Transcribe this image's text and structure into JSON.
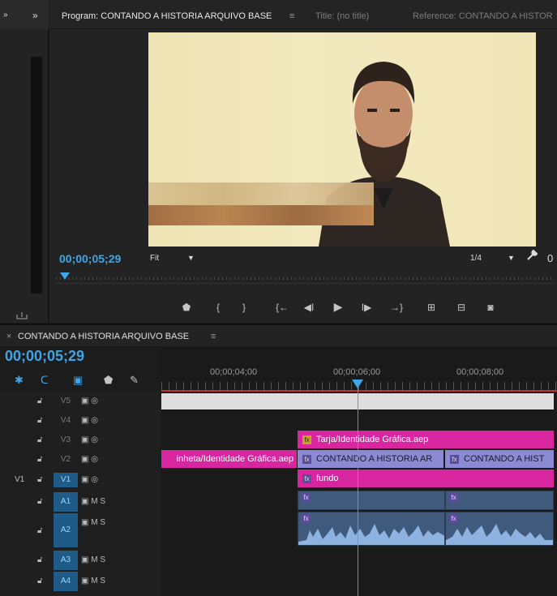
{
  "left_panel": {
    "tab_partial": "»",
    "tab_arrow": "»",
    "bottom_icon": "export-icon"
  },
  "program_monitor": {
    "tab_program": "Program: CONTANDO A HISTORIA ARQUIVO BASE",
    "tab_menu": "≡",
    "tab_title": "Title: (no title)",
    "tab_reference": "Reference: CONTANDO A HISTOR",
    "timecode": "00;00;05;29",
    "fit_label": "Fit",
    "resolution": "1/4",
    "zoom_partial": "0"
  },
  "transport": [
    "marker-icon",
    "mark-in-icon",
    "mark-out-icon",
    "go-to-in-icon",
    "step-back-icon",
    "play-icon",
    "step-forward-icon",
    "go-to-out-icon",
    "lift-icon",
    "extract-icon",
    "export-frame-icon"
  ],
  "timeline": {
    "close": "×",
    "sequence_name": "CONTANDO A HISTORIA ARQUIVO BASE",
    "menu": "≡",
    "timecode": "00;00;05;29",
    "ruler": [
      "00;00;04;00",
      "00;00;06;00",
      "00;00;08;00"
    ],
    "tracks": [
      {
        "name": "V5",
        "icons": "▣ ◎"
      },
      {
        "name": "V4",
        "icons": "▣ ◎"
      },
      {
        "name": "V3",
        "icons": "▣ ◎"
      },
      {
        "name": "V2",
        "icons": "▣ ◎"
      },
      {
        "name": "V1",
        "src": "V1",
        "icons": "▣ ◎"
      },
      {
        "name": "A1",
        "icons": "▣ M S"
      },
      {
        "name": "A2",
        "icons": "▣ M S"
      },
      {
        "name": "A3",
        "icons": "▣ M S"
      },
      {
        "name": "A4",
        "icons": "▣ M S"
      }
    ],
    "clips": {
      "v3_tarja": "Tarja/Identidade Gráfica.aep",
      "v2_vinheta": "inheta/Identidade Gráfica.aep",
      "v2_contando1": "CONTANDO A HISTORIA AR",
      "v2_contando2": "CONTANDO A HIST",
      "v1_fundo": "fundo",
      "fx": "fx"
    }
  },
  "colors": {
    "accent": "#3ea5e8",
    "pink_clip": "#d826a0",
    "lavender_clip": "#8d8ad4",
    "audio": "#3f5a7c"
  }
}
